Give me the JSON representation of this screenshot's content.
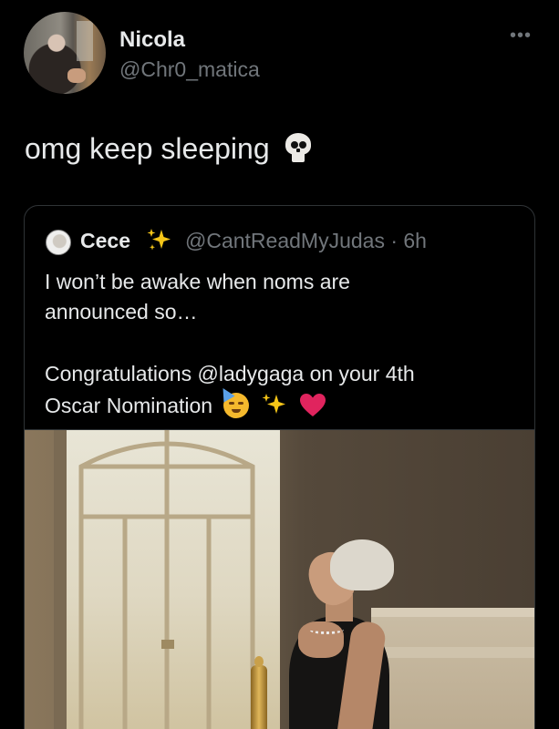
{
  "tweet": {
    "author_name": "Nicola",
    "author_handle": "@Chr0_matica",
    "more_label": "•••",
    "text": "omg keep sleeping"
  },
  "quoted_tweet": {
    "author_name": "Cece",
    "author_handle_time": "@CantReadMyJudas · 6h",
    "lines": [
      "I won’t be awake when noms are",
      "announced so…",
      "Congratulations @ladygaga on your 4th",
      "Oscar Nomination"
    ]
  },
  "icons": {
    "skull": "skull-emoji",
    "sparkles": "sparkles-emoji",
    "party_face": "partying-face-emoji",
    "heart": "red-heart-emoji"
  },
  "colors": {
    "background": "#000000",
    "text_primary": "#e7e9ea",
    "text_secondary": "#71767b",
    "border": "#2f3336",
    "heart": "#e0245e",
    "sparkle": "#f5c518"
  }
}
